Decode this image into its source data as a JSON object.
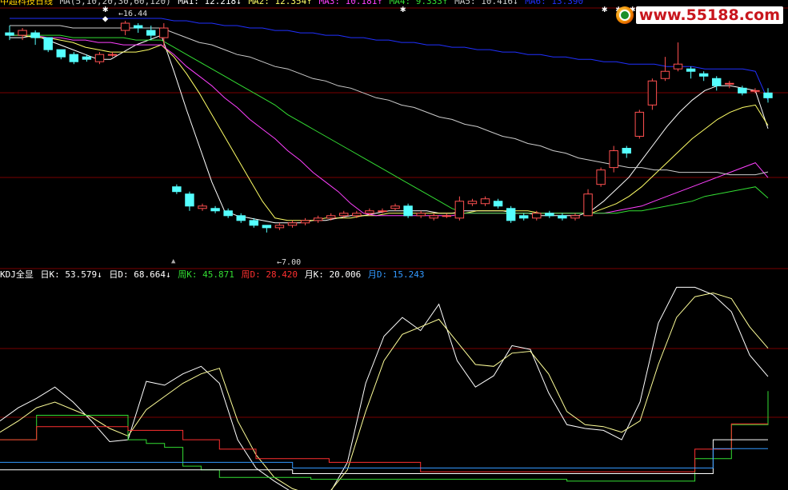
{
  "header_price": {
    "indicator_name": "中超科技日线",
    "ma_params": "MA(5,10,20,30,60,120)",
    "items": [
      {
        "label": "MA1: 12.218↓",
        "color": "#ffffff"
      },
      {
        "label": "MA2: 12.354↑",
        "color": "#ffff66"
      },
      {
        "label": "MA3: 10.181↑",
        "color": "#ff40ff"
      },
      {
        "label": "MA4: 9.333↑",
        "color": "#33dd33"
      },
      {
        "label": "MA5: 10.416↓",
        "color": "#cccccc"
      },
      {
        "label": "MA6: 13.390",
        "color": "#2030ff"
      }
    ]
  },
  "header_kdj": {
    "name": "KDJ全显",
    "items": [
      {
        "label": "日K: 53.579↓",
        "color": "#ffffff"
      },
      {
        "label": "日D: 68.664↓",
        "color": "#ffffff"
      },
      {
        "label": "周K: 45.871",
        "color": "#33dd33"
      },
      {
        "label": "周D: 28.420",
        "color": "#ff3030"
      },
      {
        "label": "月K: 20.006",
        "color": "#ffffff"
      },
      {
        "label": "月D: 15.243",
        "color": "#3399ff"
      }
    ]
  },
  "watermark": {
    "text": "www.55188.com"
  },
  "annotations": {
    "high_label": "16.44",
    "low_label": "7.00"
  },
  "colors": {
    "up": "#ff5050",
    "down": "#55ffff",
    "grid": "#7a0000"
  },
  "chart_data": [
    {
      "type": "candlestick",
      "title": "中超科技日线",
      "ylim": [
        6.6,
        16.9
      ],
      "candles": [
        [
          16.2,
          16.1,
          16.5,
          15.9
        ],
        [
          16.1,
          16.3,
          16.4,
          15.9
        ],
        [
          16.2,
          16.0,
          16.3,
          15.7
        ],
        [
          16.0,
          15.5,
          16.0,
          15.4
        ],
        [
          15.5,
          15.2,
          15.5,
          15.1
        ],
        [
          15.3,
          15.0,
          15.4,
          14.9
        ],
        [
          15.2,
          15.1,
          15.3,
          15.0
        ],
        [
          15.0,
          15.3,
          15.4,
          14.9
        ],
        [
          15.3,
          15.3,
          15.4,
          15.2
        ],
        [
          16.3,
          16.6,
          16.7,
          16.1
        ],
        [
          16.5,
          16.4,
          16.6,
          16.2
        ],
        [
          16.3,
          16.1,
          16.5,
          15.9
        ],
        [
          16.0,
          16.4,
          16.6,
          15.6
        ],
        [
          9.8,
          9.6,
          9.9,
          9.5
        ],
        [
          9.5,
          9.0,
          9.6,
          8.8
        ],
        [
          8.9,
          9.0,
          9.1,
          8.8
        ],
        [
          8.9,
          8.8,
          9.0,
          8.7
        ],
        [
          8.8,
          8.6,
          8.9,
          8.5
        ],
        [
          8.6,
          8.4,
          8.7,
          8.3
        ],
        [
          8.4,
          8.2,
          8.5,
          8.1
        ],
        [
          8.2,
          8.1,
          8.2,
          7.9
        ],
        [
          8.1,
          8.2,
          8.3,
          8.0
        ],
        [
          8.2,
          8.3,
          8.4,
          8.1
        ],
        [
          8.3,
          8.4,
          8.5,
          8.2
        ],
        [
          8.4,
          8.5,
          8.6,
          8.3
        ],
        [
          8.5,
          8.6,
          8.7,
          8.4
        ],
        [
          8.6,
          8.7,
          8.8,
          8.5
        ],
        [
          8.6,
          8.7,
          8.8,
          8.5
        ],
        [
          8.7,
          8.8,
          8.9,
          8.6
        ],
        [
          8.8,
          8.8,
          8.9,
          8.7
        ],
        [
          8.9,
          9.0,
          9.1,
          8.8
        ],
        [
          9.0,
          8.6,
          9.1,
          8.5
        ],
        [
          8.6,
          8.7,
          8.8,
          8.5
        ],
        [
          8.5,
          8.6,
          8.7,
          8.4
        ],
        [
          8.6,
          8.6,
          8.7,
          8.5
        ],
        [
          8.5,
          9.2,
          9.4,
          8.4
        ],
        [
          9.1,
          9.2,
          9.3,
          9.0
        ],
        [
          9.1,
          9.3,
          9.4,
          9.0
        ],
        [
          9.2,
          9.0,
          9.3,
          8.9
        ],
        [
          8.9,
          8.4,
          9.0,
          8.3
        ],
        [
          8.6,
          8.5,
          8.7,
          8.4
        ],
        [
          8.5,
          8.7,
          8.8,
          8.4
        ],
        [
          8.7,
          8.6,
          8.8,
          8.5
        ],
        [
          8.6,
          8.5,
          8.7,
          8.4
        ],
        [
          8.5,
          8.6,
          8.7,
          8.4
        ],
        [
          8.6,
          9.5,
          9.7,
          8.6
        ],
        [
          9.9,
          10.5,
          10.6,
          9.8
        ],
        [
          10.6,
          11.3,
          11.5,
          10.4
        ],
        [
          11.4,
          11.2,
          11.5,
          11.0
        ],
        [
          11.9,
          12.9,
          13.0,
          11.8
        ],
        [
          13.2,
          14.2,
          14.3,
          13.0
        ],
        [
          14.3,
          14.6,
          15.2,
          14.2
        ],
        [
          14.7,
          14.9,
          15.8,
          14.6
        ],
        [
          14.7,
          14.6,
          14.8,
          14.3
        ],
        [
          14.5,
          14.4,
          14.6,
          14.2
        ],
        [
          14.3,
          14.0,
          14.4,
          13.8
        ],
        [
          14.1,
          14.1,
          14.2,
          13.9
        ],
        [
          13.9,
          13.7,
          14.0,
          13.6
        ],
        [
          13.8,
          13.8,
          13.9,
          13.7
        ],
        [
          13.7,
          13.5,
          13.9,
          13.3
        ]
      ],
      "series": [
        {
          "name": "MA1",
          "color": "#ffffff",
          "values": [
            16.0,
            16.0,
            16.1,
            15.9,
            15.7,
            15.5,
            15.3,
            15.1,
            15.1,
            15.4,
            15.7,
            15.9,
            16.1,
            14.6,
            13.0,
            11.5,
            10.0,
            8.8,
            8.6,
            8.5,
            8.4,
            8.3,
            8.3,
            8.3,
            8.4,
            8.4,
            8.5,
            8.6,
            8.6,
            8.7,
            8.8,
            8.8,
            8.8,
            8.8,
            8.7,
            8.7,
            8.8,
            8.8,
            8.8,
            8.8,
            8.7,
            8.7,
            8.6,
            8.6,
            8.6,
            8.6,
            8.8,
            9.2,
            9.7,
            10.2,
            10.9,
            11.6,
            12.3,
            12.9,
            13.4,
            13.8,
            14.0,
            14.0,
            13.9,
            13.8,
            12.218
          ]
        },
        {
          "name": "MA2",
          "color": "#ffff66",
          "values": [
            16.1,
            16.1,
            16.0,
            16.0,
            15.9,
            15.8,
            15.6,
            15.5,
            15.4,
            15.4,
            15.4,
            15.5,
            15.7,
            15.2,
            14.5,
            13.7,
            12.8,
            11.9,
            11.0,
            10.1,
            9.2,
            8.5,
            8.4,
            8.4,
            8.4,
            8.5,
            8.5,
            8.5,
            8.6,
            8.6,
            8.7,
            8.7,
            8.7,
            8.7,
            8.7,
            8.7,
            8.7,
            8.8,
            8.8,
            8.8,
            8.8,
            8.8,
            8.7,
            8.7,
            8.7,
            8.7,
            8.7,
            8.9,
            9.1,
            9.4,
            9.8,
            10.3,
            10.8,
            11.3,
            11.8,
            12.2,
            12.6,
            12.9,
            13.1,
            13.2,
            12.354
          ]
        },
        {
          "name": "MA3",
          "color": "#ff40ff",
          "values": [
            16.1,
            16.1,
            16.1,
            16.0,
            16.0,
            15.9,
            15.9,
            15.8,
            15.8,
            15.7,
            15.7,
            15.7,
            15.7,
            15.3,
            14.8,
            14.4,
            14.0,
            13.5,
            13.1,
            12.6,
            12.2,
            11.8,
            11.3,
            10.9,
            10.4,
            10.0,
            9.6,
            9.1,
            8.7,
            8.6,
            8.6,
            8.6,
            8.6,
            8.6,
            8.6,
            8.6,
            8.7,
            8.7,
            8.7,
            8.7,
            8.7,
            8.7,
            8.7,
            8.7,
            8.7,
            8.7,
            8.7,
            8.7,
            8.8,
            8.9,
            9.0,
            9.2,
            9.4,
            9.6,
            9.8,
            10.0,
            10.2,
            10.4,
            10.6,
            10.8,
            10.181
          ]
        },
        {
          "name": "MA4",
          "color": "#33dd33",
          "values": [
            16.1,
            16.1,
            16.1,
            16.1,
            16.1,
            16.0,
            16.0,
            16.0,
            16.0,
            16.0,
            15.9,
            15.9,
            15.9,
            15.6,
            15.3,
            15.0,
            14.7,
            14.4,
            14.1,
            13.8,
            13.5,
            13.2,
            12.8,
            12.5,
            12.2,
            11.9,
            11.6,
            11.3,
            11.0,
            10.7,
            10.4,
            10.1,
            9.8,
            9.5,
            9.2,
            8.9,
            8.7,
            8.7,
            8.7,
            8.7,
            8.7,
            8.7,
            8.7,
            8.7,
            8.7,
            8.7,
            8.7,
            8.7,
            8.7,
            8.8,
            8.8,
            8.9,
            9.0,
            9.1,
            9.2,
            9.4,
            9.5,
            9.6,
            9.7,
            9.8,
            9.333
          ]
        },
        {
          "name": "MA5",
          "color": "#cccccc",
          "values": [
            16.5,
            16.5,
            16.5,
            16.5,
            16.5,
            16.4,
            16.4,
            16.4,
            16.4,
            16.4,
            16.4,
            16.4,
            16.4,
            16.2,
            16.0,
            15.8,
            15.7,
            15.5,
            15.3,
            15.2,
            15.0,
            14.8,
            14.7,
            14.5,
            14.3,
            14.2,
            14.0,
            13.9,
            13.7,
            13.5,
            13.4,
            13.2,
            13.1,
            12.9,
            12.7,
            12.6,
            12.4,
            12.3,
            12.1,
            11.9,
            11.8,
            11.6,
            11.5,
            11.3,
            11.2,
            11.0,
            10.9,
            10.8,
            10.7,
            10.6,
            10.6,
            10.5,
            10.5,
            10.4,
            10.4,
            10.4,
            10.4,
            10.3,
            10.3,
            10.3,
            10.416
          ]
        },
        {
          "name": "MA6",
          "color": "#2030ff",
          "values": [
            16.8,
            16.8,
            16.8,
            16.8,
            16.8,
            16.8,
            16.8,
            16.8,
            16.8,
            16.8,
            16.8,
            16.8,
            16.8,
            16.7,
            16.7,
            16.6,
            16.6,
            16.5,
            16.5,
            16.4,
            16.4,
            16.3,
            16.3,
            16.2,
            16.2,
            16.1,
            16.1,
            16.0,
            16.0,
            15.9,
            15.9,
            15.8,
            15.8,
            15.7,
            15.7,
            15.6,
            15.6,
            15.5,
            15.5,
            15.4,
            15.4,
            15.3,
            15.3,
            15.2,
            15.2,
            15.1,
            15.1,
            15.0,
            15.0,
            14.9,
            14.9,
            14.9,
            14.8,
            14.8,
            14.8,
            14.7,
            14.7,
            14.7,
            14.7,
            14.6,
            13.39
          ]
        }
      ]
    },
    {
      "type": "line",
      "title": "KDJ全显",
      "ylim": [
        -5,
        105
      ],
      "series": [
        {
          "name": "日K",
          "color": "#ffffff",
          "values": [
            30,
            37,
            42,
            48,
            40,
            30,
            19,
            20,
            51,
            49,
            55,
            59,
            50,
            20,
            5,
            -2,
            -8,
            -12,
            -9,
            8,
            50,
            75,
            85,
            78,
            92,
            62,
            48,
            54,
            70,
            68,
            45,
            28,
            26,
            25,
            20,
            40,
            82,
            101,
            101,
            97,
            88,
            65,
            53.579
          ]
        },
        {
          "name": "日D",
          "color": "#ffff99",
          "values": [
            24,
            30,
            37,
            40,
            36,
            32,
            26,
            22,
            36,
            43,
            50,
            55,
            58,
            30,
            12,
            0,
            -6,
            -9,
            -8,
            4,
            35,
            62,
            76,
            80,
            84,
            72,
            60,
            59,
            66,
            67,
            55,
            35,
            28,
            27,
            24,
            30,
            60,
            85,
            96,
            98,
            95,
            80,
            68.664
          ]
        },
        {
          "name": "周K",
          "color": "#33dd33",
          "values": [
            20,
            20,
            33,
            33,
            33,
            33,
            33,
            20,
            18,
            16,
            6,
            4,
            0,
            0,
            0,
            0,
            0,
            -1,
            -1,
            -1,
            -1,
            -1,
            -1,
            -1,
            -1,
            -1,
            -1,
            -1,
            -1,
            -1,
            -1,
            -2,
            -2,
            -2,
            -2,
            -2,
            -2,
            -2,
            10,
            10,
            28,
            28,
            45.871
          ]
        },
        {
          "name": "周D",
          "color": "#ff3030",
          "values": [
            20,
            20,
            27,
            27,
            27,
            27,
            27,
            25,
            25,
            25,
            20,
            20,
            15,
            15,
            10,
            10,
            10,
            10,
            8,
            8,
            8,
            8,
            8,
            3,
            3,
            3,
            3,
            3,
            3,
            3,
            3,
            3,
            3,
            3,
            3,
            3,
            3,
            3,
            15,
            15,
            28.42,
            28.42,
            28.42
          ]
        },
        {
          "name": "月K",
          "color": "#ffffff",
          "values": [
            4,
            4,
            4,
            4,
            4,
            4,
            4,
            4,
            4,
            4,
            4,
            4,
            4,
            4,
            4,
            4,
            2,
            2,
            2,
            2,
            2,
            2,
            2,
            2,
            2,
            2,
            2,
            2,
            2,
            2,
            2,
            2,
            2,
            2,
            2,
            2,
            2,
            2,
            2,
            20.006,
            20.006,
            20.006,
            20.006
          ]
        },
        {
          "name": "月D",
          "color": "#3399ff",
          "values": [
            8,
            8,
            8,
            8,
            8,
            8,
            8,
            8,
            8,
            8,
            8,
            8,
            8,
            8,
            8,
            8,
            5,
            5,
            5,
            5,
            5,
            5,
            5,
            5,
            5,
            5,
            5,
            5,
            5,
            5,
            5,
            5,
            5,
            5,
            5,
            5,
            5,
            5,
            5,
            15.243,
            15.243,
            15.243,
            15.243
          ]
        }
      ]
    }
  ]
}
